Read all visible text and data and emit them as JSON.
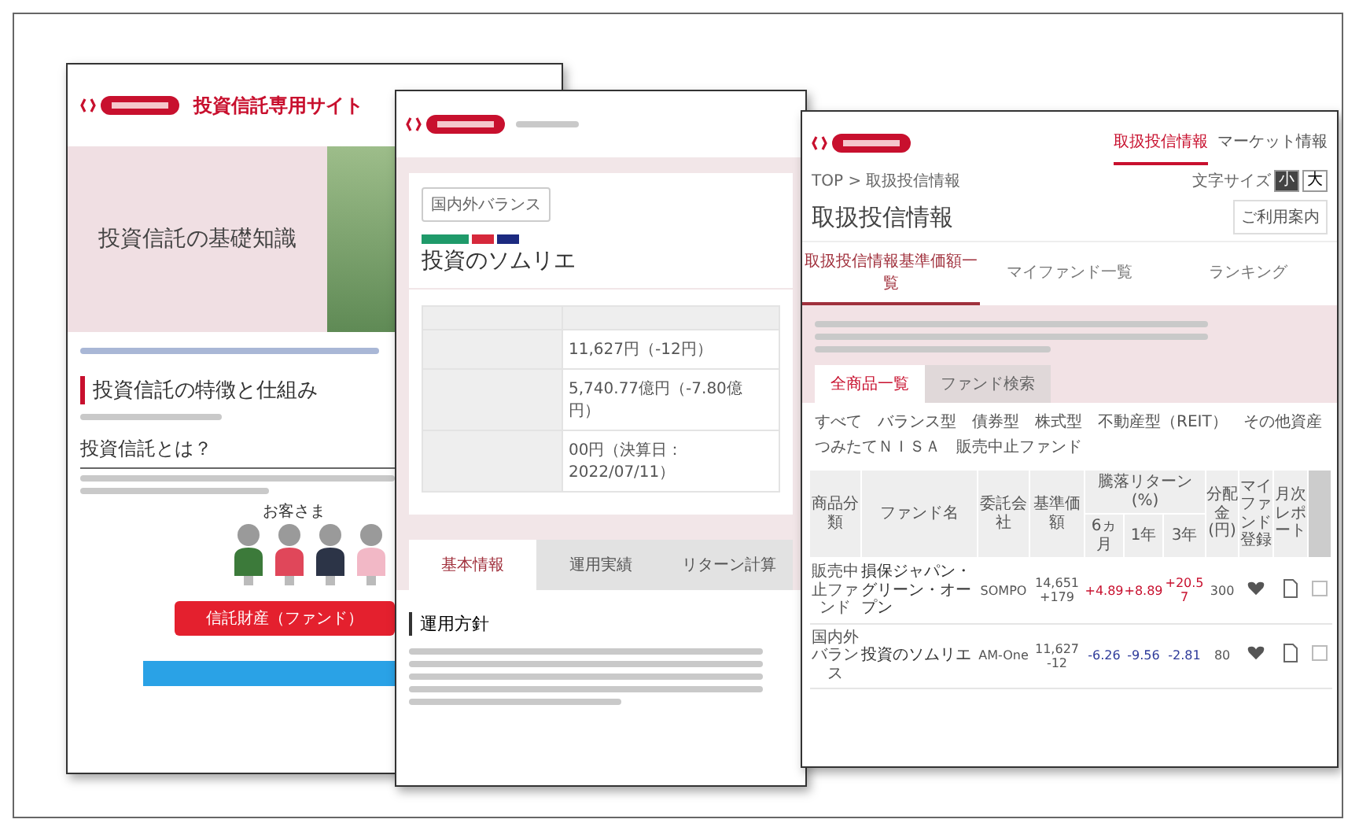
{
  "basics_page": {
    "site_title": "投資信託専用サイト",
    "hero_title": "投資信託の基礎知識",
    "section_title": "投資信託の特徴と仕組み",
    "subsection_title": "投資信託とは？",
    "diagram": {
      "customers_label": "お客さま",
      "people": [
        {
          "color": "#3c7a3a"
        },
        {
          "color": "#e0475a"
        },
        {
          "color": "#2c3447"
        },
        {
          "color": "#f2b8c6"
        }
      ],
      "fund_label": "信託財産（ファンド）"
    }
  },
  "fund_detail_page": {
    "category_button": "国内外バランス",
    "tags": [
      {
        "color": "#1f9a6a"
      },
      {
        "color": "#d6283b"
      },
      {
        "color": "#1c2a80"
      }
    ],
    "fund_name": "投資のソムリエ",
    "values": [
      "11,627円（-12円）",
      "5,740.77億円（-7.80億円）",
      "00円（決算日：2022/07/11）"
    ],
    "tabs": [
      {
        "label": "基本情報",
        "selected": true
      },
      {
        "label": "運用実績",
        "selected": false
      },
      {
        "label": "リターン計算",
        "selected": false
      }
    ],
    "policy_title": "運用方針"
  },
  "fund_list_page": {
    "nav": [
      {
        "label": "取扱投信情報",
        "selected": true
      },
      {
        "label": "マーケット情報",
        "selected": false
      }
    ],
    "breadcrumb": "TOP > 取扱投信情報",
    "font_size_label": "文字サイズ",
    "font_sizes": [
      {
        "label": "小",
        "selected": true
      },
      {
        "label": "大",
        "selected": false
      }
    ],
    "title": "取扱投信情報",
    "guide_button": "ご利用案内",
    "tabs": [
      {
        "label": "取扱投信情報基準価額一覧",
        "selected": true
      },
      {
        "label": "マイファンド一覧",
        "selected": false
      },
      {
        "label": "ランキング",
        "selected": false
      }
    ],
    "sub_tabs": [
      {
        "label": "全商品一覧",
        "selected": true
      },
      {
        "label": "ファンド検索",
        "selected": false
      }
    ],
    "filters": [
      "すべて",
      "バランス型",
      "債券型",
      "株式型",
      "不動産型（REIT）",
      "その他資産",
      "つみたてＮＩＳＡ",
      "販売中止ファンド"
    ],
    "columns": [
      "商品分類",
      "ファンド名",
      "委託会社",
      "基準価額",
      "騰落リターン(%)",
      "6ヵ月",
      "1年",
      "3年",
      "分配金(円)",
      "マイファンド登録",
      "月次レポート"
    ],
    "rows": [
      {
        "category": "販売中止ファンド",
        "fund": "損保ジャパン・グリーン・オープン",
        "company": "SOMPO",
        "price": "14,651",
        "change": "+179",
        "returns": [
          {
            "value": "+4.89",
            "color": "#c8102e"
          },
          {
            "value": "+8.89",
            "color": "#c8102e"
          },
          {
            "value": "+20.57",
            "color": "#c8102e"
          }
        ],
        "dividend": "300",
        "checked": false
      },
      {
        "category": "国内外バランス",
        "fund": "投資のソムリエ",
        "company": "AM-One",
        "price": "11,627",
        "change": "-12",
        "returns": [
          {
            "value": "-6.26",
            "color": "#2d3a9a"
          },
          {
            "value": "-9.56",
            "color": "#2d3a9a"
          },
          {
            "value": "-2.81",
            "color": "#2d3a9a"
          }
        ],
        "dividend": "80",
        "checked": false
      }
    ]
  }
}
